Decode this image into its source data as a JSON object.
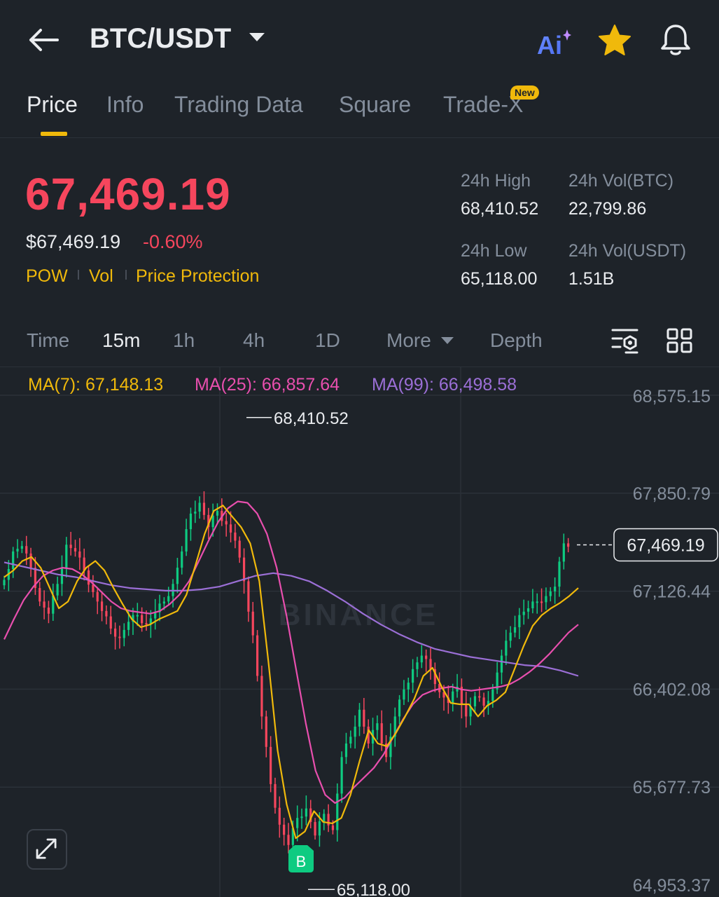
{
  "header": {
    "pair": "BTC/USDT",
    "ai_label": "Ai",
    "icons": [
      "back-arrow-icon",
      "caret-down-icon",
      "ai-icon",
      "star-icon",
      "bell-icon"
    ],
    "star_color": "#f0b90b"
  },
  "tabs": [
    {
      "label": "Price",
      "active": true
    },
    {
      "label": "Info",
      "active": false
    },
    {
      "label": "Trading Data",
      "active": false
    },
    {
      "label": "Square",
      "active": false
    },
    {
      "label": "Trade-X",
      "active": false,
      "badge": "New"
    }
  ],
  "price": {
    "last": "67,469.19",
    "usd": "$67,469.19",
    "change": "-0.60%",
    "tags": [
      "POW",
      "Vol",
      "Price Protection"
    ]
  },
  "stats": {
    "high_label": "24h High",
    "high_value": "68,410.52",
    "volbtc_label": "24h Vol(BTC)",
    "volbtc_value": "22,799.86",
    "low_label": "24h Low",
    "low_value": "65,118.00",
    "volusdt_label": "24h Vol(USDT)",
    "volusdt_value": "1.51B"
  },
  "intervals": {
    "items": [
      "Time",
      "15m",
      "1h",
      "4h",
      "1D",
      "More",
      "Depth"
    ],
    "active": "15m"
  },
  "ma": {
    "ma7": "MA(7): 67,148.13",
    "ma25": "MA(25): 66,857.64",
    "ma99": "MA(99): 66,498.58"
  },
  "colors": {
    "up": "#0ecb81",
    "down": "#f6465d",
    "accent": "#f0b90b",
    "ma7": "#f0b90b",
    "ma25": "#e84fae",
    "ma99": "#9b6fd6",
    "background": "#1e2329"
  },
  "chart_data": {
    "type": "candlestick",
    "y_ticks": [
      "68,575.15",
      "67,850.79",
      "67,126.44",
      "66,402.08",
      "65,677.73",
      "64,953.37"
    ],
    "ylim": [
      64953.37,
      68575.15
    ],
    "current_price_label": "67,469.19",
    "current_price": 67469.19,
    "high_label": "68,410.52",
    "high": 68410.52,
    "low_label": "65,118.00",
    "low": 65118.0,
    "buy_marker": "B",
    "watermark": "BINANCE",
    "closes": [
      67210,
      67420,
      67460,
      67300,
      67050,
      66960,
      67180,
      67470,
      67420,
      67280,
      67120,
      66980,
      66850,
      66780,
      66900,
      66950,
      66880,
      66970,
      67050,
      67180,
      67420,
      67700,
      67780,
      67600,
      67720,
      67620,
      67500,
      67200,
      66800,
      66200,
      65700,
      65400,
      65250,
      65450,
      65520,
      65320,
      65480,
      65360,
      65900,
      66050,
      66250,
      66000,
      66150,
      65900,
      66200,
      66400,
      66550,
      66650,
      66550,
      66380,
      66300,
      66420,
      66200,
      66350,
      66280,
      66400,
      66650,
      66820,
      66950,
      67000,
      67050,
      67090,
      67160,
      67480
    ],
    "ma7": [
      67230,
      67280,
      67350,
      67380,
      67300,
      67150,
      67000,
      67050,
      67200,
      67300,
      67350,
      67280,
      67150,
      67030,
      66920,
      66860,
      66880,
      66920,
      66950,
      66980,
      67100,
      67320,
      67550,
      67720,
      67760,
      67680,
      67600,
      67480,
      67200,
      66600,
      65950,
      65550,
      65300,
      65350,
      65500,
      65420,
      65410,
      65450,
      65620,
      65870,
      66100,
      66000,
      65980,
      66080,
      66200,
      66330,
      66500,
      66560,
      66420,
      66300,
      66290,
      66290,
      66200,
      66280,
      66320,
      66380,
      66550,
      66720,
      66870,
      66950,
      67000,
      67040,
      67090,
      67150
    ],
    "ma25": [
      66770,
      66920,
      67060,
      67160,
      67240,
      67280,
      67300,
      67290,
      67250,
      67190,
      67120,
      67050,
      67000,
      66980,
      66970,
      66960,
      66980,
      67030,
      67100,
      67200,
      67350,
      67500,
      67640,
      67740,
      67790,
      67780,
      67700,
      67550,
      67300,
      66950,
      66550,
      66150,
      65800,
      65620,
      65560,
      65600,
      65680,
      65750,
      65820,
      65920,
      66050,
      66180,
      66290,
      66360,
      66390,
      66410,
      66420,
      66400,
      66390,
      66400,
      66410,
      66420,
      66440,
      66480,
      66530,
      66590,
      66660,
      66740,
      66820,
      66880
    ],
    "ma99": [
      67340,
      67310,
      67280,
      67250,
      67230,
      67200,
      67170,
      67150,
      67140,
      67130,
      67130,
      67140,
      67160,
      67200,
      67240,
      67260,
      67240,
      67200,
      67130,
      67050,
      66960,
      66880,
      66810,
      66750,
      66700,
      66670,
      66640,
      66620,
      66600,
      66580,
      66570,
      66540,
      66500
    ]
  }
}
